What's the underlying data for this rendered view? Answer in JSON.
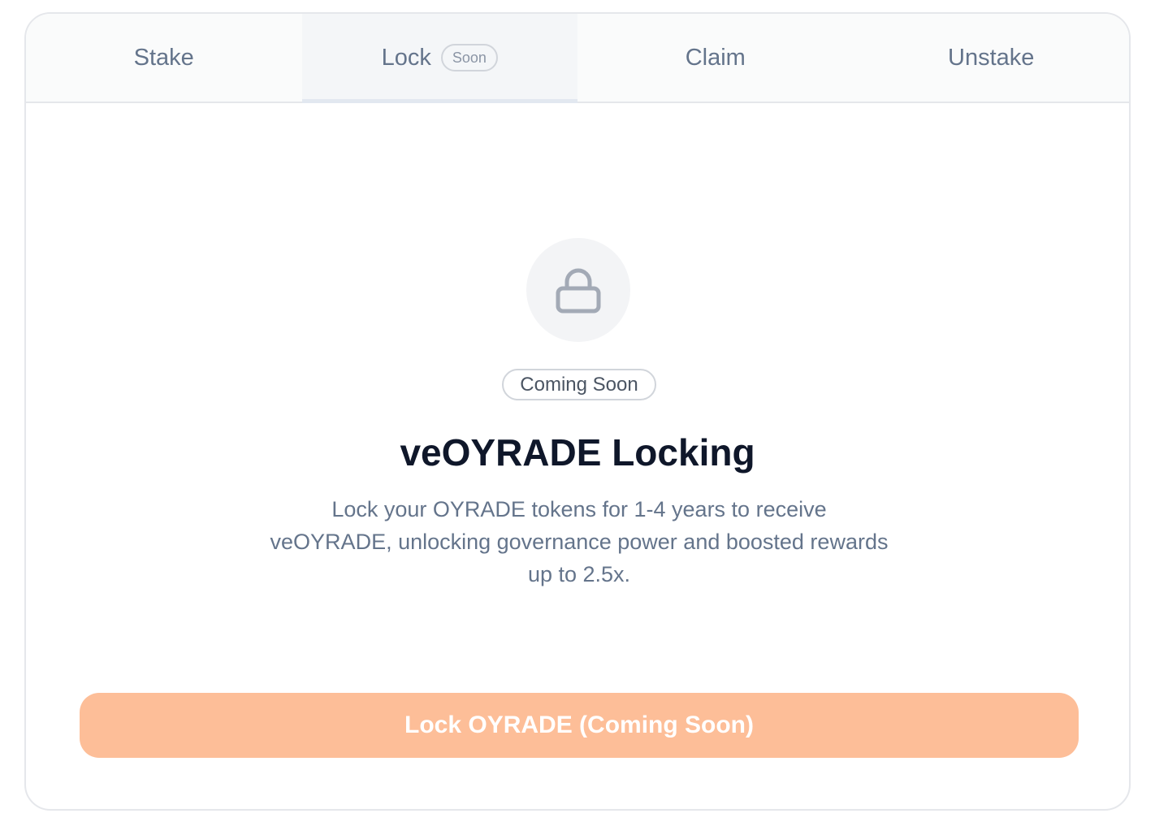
{
  "tabs": [
    {
      "label": "Stake"
    },
    {
      "label": "Lock",
      "badge": "Soon",
      "active": true
    },
    {
      "label": "Claim"
    },
    {
      "label": "Unstake"
    }
  ],
  "panel": {
    "icon": "lock-icon",
    "status_badge": "Coming Soon",
    "title": "veOYRADE Locking",
    "description": "Lock your OYRADE tokens for 1-4 years to receive veOYRADE, unlocking governance power and boosted rewards up to 2.5x.",
    "button_label": "Lock OYRADE (Coming Soon)"
  },
  "colors": {
    "button_bg": "#fdbe98",
    "title": "#0f172a",
    "muted_text": "#64748b"
  }
}
